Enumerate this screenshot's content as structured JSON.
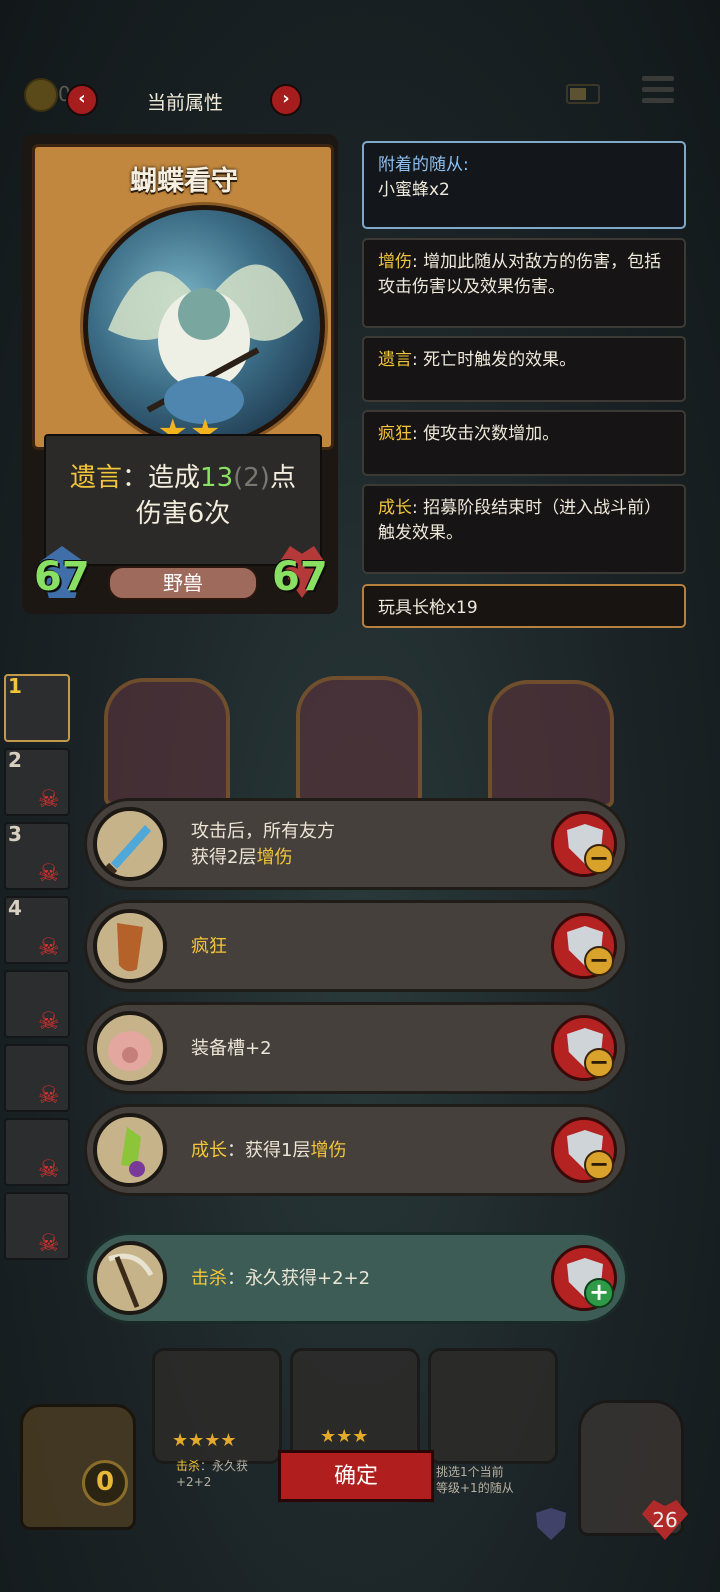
{
  "topbar": {
    "coin_value": "0 8",
    "title": "当前属性",
    "left_arrow": "‹",
    "right_arrow": "›"
  },
  "card": {
    "name": "蝴蝶看守",
    "stars": "★★",
    "ability_keyword": "遗言",
    "ability_pre": "：造成",
    "ability_num": "13",
    "ability_bonus": "(2)",
    "ability_post": "点",
    "ability_line2": "伤害6次",
    "attack": "67",
    "health": "67",
    "tribe": "野兽"
  },
  "keywords": {
    "attached_title": "附着的随从:",
    "attached_value": "小蜜蜂x2",
    "damage_name": "增伤",
    "damage_desc": ": 增加此随从对敌方的伤害，包括攻击伤害以及效果伤害。",
    "deathrattle_name": "遗言",
    "deathrattle_desc": ": 死亡时触发的效果。",
    "frenzy_name": "疯狂",
    "frenzy_desc": ": 使攻击次数增加。",
    "growth_name": "成长",
    "growth_desc": ": 招募阶段结束时（进入战斗前）触发效果。",
    "toy_title": "玩具长枪x19"
  },
  "lineup": [
    {
      "num": "1",
      "dead": false
    },
    {
      "num": "2",
      "dead": true
    },
    {
      "num": "3",
      "dead": true
    },
    {
      "num": "4",
      "dead": true
    },
    {
      "num": "",
      "dead": true
    },
    {
      "num": "",
      "dead": true
    },
    {
      "num": "",
      "dead": true
    },
    {
      "num": "",
      "dead": true
    }
  ],
  "equipment": [
    {
      "line1": "攻击后，所有友方",
      "line2_pre": "获得2层",
      "line2_kw": "增伤",
      "icon": "dagger-icon",
      "action": "remove"
    },
    {
      "kw": "疯狂",
      "icon": "horn-icon",
      "action": "remove"
    },
    {
      "text": "装备槽+2",
      "icon": "pig-icon",
      "action": "remove"
    },
    {
      "kw": "成长",
      "rest_pre": "：获得1层",
      "rest_kw": "增伤",
      "icon": "crystal-icon",
      "action": "remove"
    },
    {
      "kw": "击杀",
      "rest": "：永久获得+2+2",
      "icon": "scythe-icon",
      "action": "add"
    }
  ],
  "bottom": {
    "confirm": "确定",
    "gold": "0",
    "hero_health": "26",
    "shop1_stars": "★★★★",
    "shop1_text_kw": "击杀",
    "shop1_text": "：永久获",
    "shop1_text2": "+2+2",
    "shop2_stars": "★★★",
    "shop3_text": "挑选1个当前",
    "shop3_text2": "等级+1的随从"
  },
  "colors": {
    "keyword": "#f2c53a",
    "highlight_green": "#8ae063",
    "button_red": "#b01e1e"
  }
}
